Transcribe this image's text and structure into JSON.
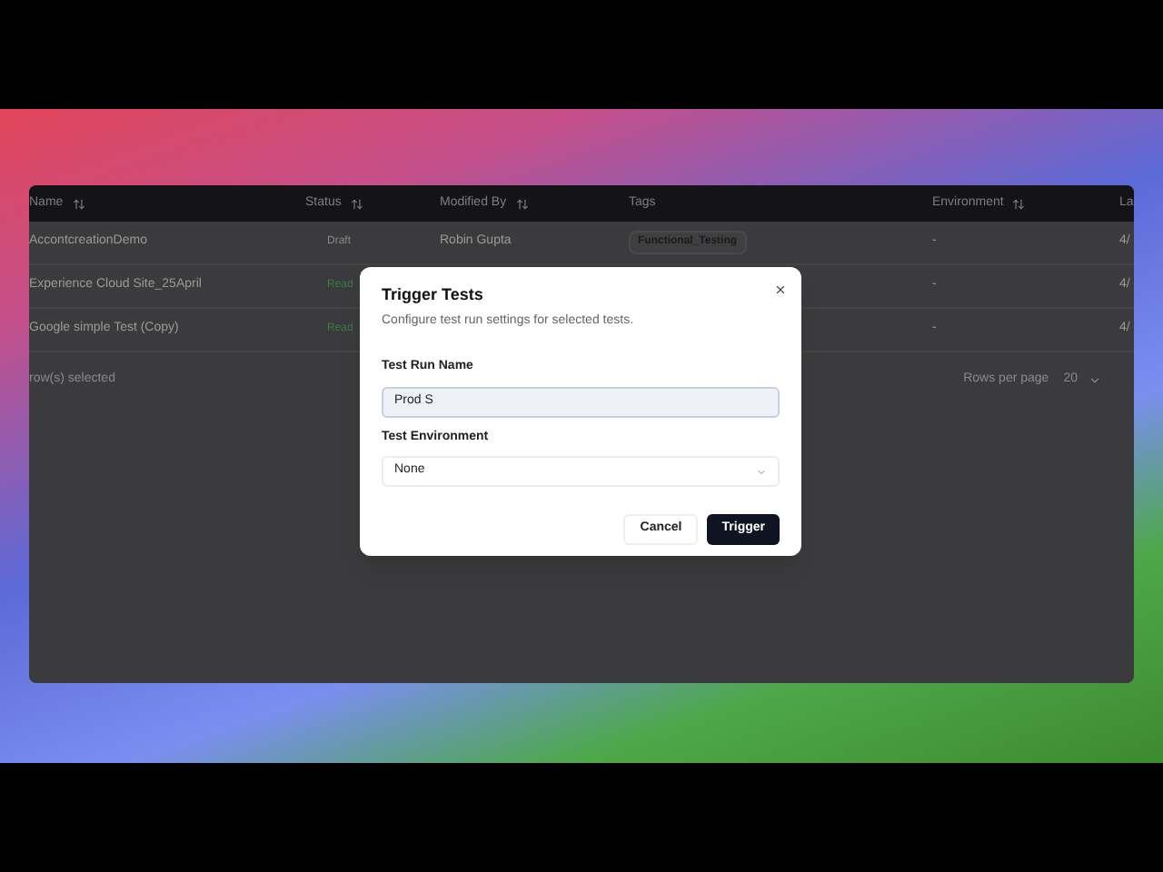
{
  "table": {
    "columns": [
      {
        "label": "Name",
        "sortable": true
      },
      {
        "label": "Status",
        "sortable": true
      },
      {
        "label": "Modified By",
        "sortable": true
      },
      {
        "label": "Tags",
        "sortable": false
      },
      {
        "label": "Environment",
        "sortable": true
      },
      {
        "label": "La",
        "sortable": false
      }
    ],
    "rows": [
      {
        "name": "AccontcreationDemo",
        "status": {
          "text": "Draft",
          "kind": "draft"
        },
        "modified_by": "Robin Gupta",
        "tags": [
          "Functional_Testing"
        ],
        "environment": "-",
        "column_6": "4/"
      },
      {
        "name": "Experience Cloud Site_25April",
        "status": {
          "text": "Read",
          "kind": "ready"
        },
        "environment": "-",
        "column_6": "4/"
      },
      {
        "name": "Google simple Test (Copy)",
        "status": {
          "text": "Read",
          "kind": "ready"
        },
        "environment": "-",
        "column_6": "4/"
      }
    ]
  },
  "footer": {
    "selection": "row(s) selected",
    "rows_per_page_label": "Rows per page",
    "rows_per_page": "20"
  },
  "dialog": {
    "title": "Trigger Tests",
    "description": "Configure test run settings for selected tests.",
    "name_label": "Test Run Name",
    "name_value": "Prod S",
    "name_focused": true,
    "environment_label": "Test Environment",
    "environment_value": "None",
    "buttons": [
      {
        "label": "Cancel",
        "kind": "secondary"
      },
      {
        "label": "Trigger",
        "kind": "primary"
      }
    ]
  }
}
